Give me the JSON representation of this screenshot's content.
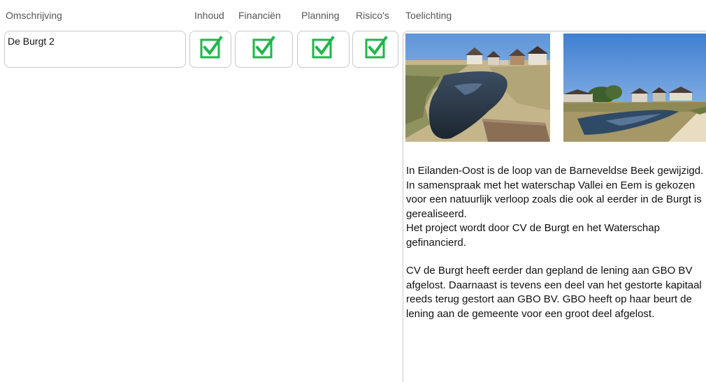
{
  "headers": {
    "omschrijving": "Omschrijving",
    "inhoud": "Inhoud",
    "financien": "Financiën",
    "planning": "Planning",
    "risicos": "Risico's",
    "toelichting": "Toelichting"
  },
  "row": {
    "omschrijving": "De Burgt 2",
    "inhoud_checked": true,
    "financien_checked": true,
    "planning_checked": true,
    "risicos_checked": true,
    "toelichting": {
      "paragraph_1": "In Eilanden-Oost is de loop van de Barneveldse Beek gewijzigd. In samenspraak met het waterschap Vallei en Eem is gekozen voor een natuurlijk verloop zoals die ook al eerder in de Burgt is gerealiseerd.\nHet project wordt door CV de Burgt en het Waterschap gefinancierd.",
      "paragraph_2": "CV de Burgt heeft eerder dan gepland de lening aan GBO BV afgelost. Daarnaast is tevens een deel van het gestorte kapitaal reeds terug gestort aan GBO BV. GBO heeft op haar beurt de lening aan de gemeente voor een groot deel afgelost."
    }
  },
  "colors": {
    "check_green": "#1fb64a",
    "border": "#c8c8c8"
  }
}
